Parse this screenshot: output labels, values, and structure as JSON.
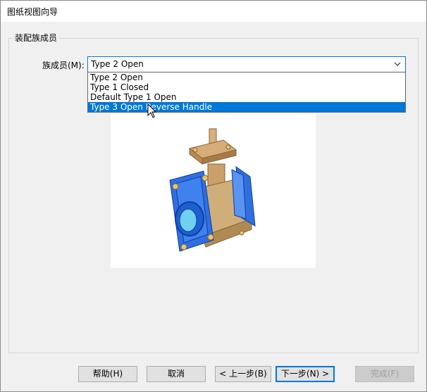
{
  "window": {
    "title": "图纸视图向导"
  },
  "group": {
    "title": "装配族成员"
  },
  "combo": {
    "label": "族成员(M):",
    "value": "Type 2 Open",
    "options": [
      {
        "label": "Type 2 Open",
        "selected": false
      },
      {
        "label": "Type 1 Closed",
        "selected": false
      },
      {
        "label": "Default Type 1 Open",
        "selected": false
      },
      {
        "label": "Type 3 Open Reverse Handle",
        "selected": true
      }
    ]
  },
  "preview": {
    "icon": "valve-assembly-image"
  },
  "buttons": {
    "help": "帮助(H)",
    "cancel": "取消",
    "back": "< 上一步(B)",
    "next": "下一步(N) >",
    "finish": "完成(F)"
  },
  "colors": {
    "accent": "#0078d7",
    "valve_body": "#2f6fe0",
    "valve_brass": "#c9a06a"
  }
}
